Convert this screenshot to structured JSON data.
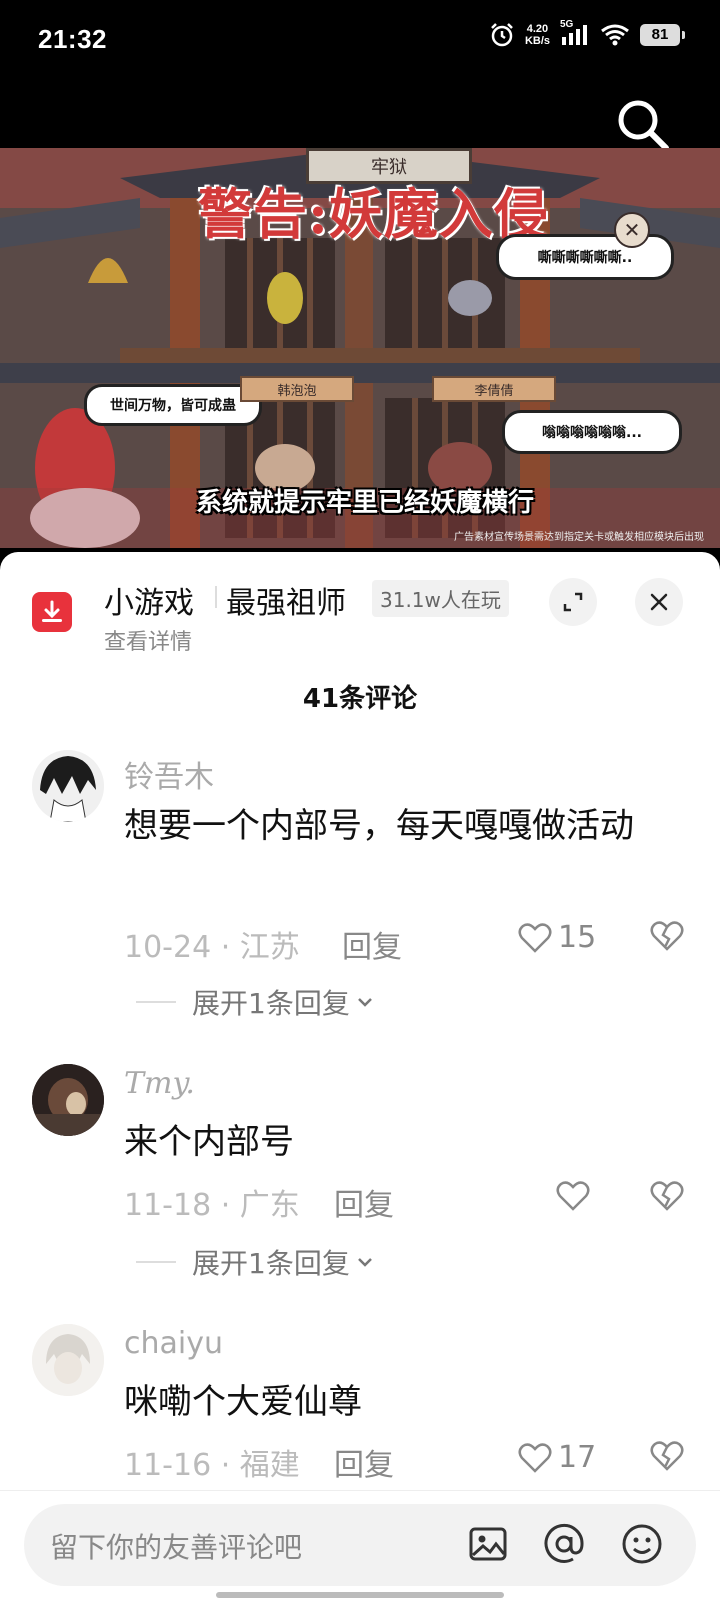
{
  "status_bar": {
    "time": "21:32",
    "net_speed_value": "4.20",
    "net_speed_unit": "KB/s",
    "network_type": "5G",
    "battery": "81"
  },
  "video": {
    "sign_prison": "牢狱",
    "banner_title": "警告:妖魔入侵",
    "speech_top": "嘶嘶嘶嘶嘶嘶..",
    "speech_left": "世间万物，皆可成蛊",
    "speech_right": "嗡嗡嗡嗡嗡嗡...",
    "name_left": "韩泡泡",
    "name_right": "李倩倩",
    "subtitle": "系统就提示牢里已经妖魔横行",
    "disclaimer": "广告素材宣传场景需达到指定关卡或触发相应模块后出现"
  },
  "game": {
    "type": "小游戏",
    "name": "最强祖师",
    "players": "31.1w人在玩",
    "detail": "查看详情"
  },
  "comments_header": "41条评论",
  "comments": [
    {
      "user": "铃吾木",
      "text": "想要一个内部号，每天嘎嘎做活动",
      "date_loc": "10-24 · 江苏",
      "reply": "回复",
      "likes": "15",
      "expand": "展开1条回复"
    },
    {
      "user": "Tmy.",
      "text": "来个内部号",
      "date_loc": "11-18 · 广东",
      "reply": "回复",
      "likes": "",
      "expand": "展开1条回复"
    },
    {
      "user": "chaiyu",
      "text": "咪嘞个大爱仙尊",
      "date_loc": "11-16 · 福建",
      "reply": "回复",
      "likes": "17"
    }
  ],
  "input": {
    "placeholder": "留下你的友善评论吧"
  },
  "colors": {
    "brand_red": "#e8323c",
    "sheet_bg": "#ffffff",
    "input_bg": "#f2f2f2"
  }
}
